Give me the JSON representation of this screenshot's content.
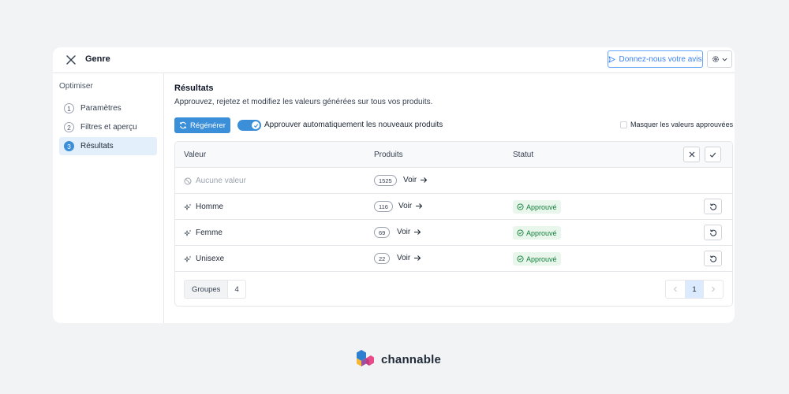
{
  "window": {
    "title": "Genre",
    "feedback_label": "Donnez-nous votre avis"
  },
  "sidebar": {
    "heading": "Optimiser",
    "steps": [
      {
        "num": "1",
        "label": "Paramètres"
      },
      {
        "num": "2",
        "label": "Filtres et aperçu"
      },
      {
        "num": "3",
        "label": "Résultats",
        "active": true
      }
    ]
  },
  "main": {
    "title": "Résultats",
    "description": "Approuvez, rejetez et modifiez les valeurs générées sur tous vos produits.",
    "regenerate_label": "Régénérer",
    "auto_approve_label": "Approuver automatiquement les nouveaux produits",
    "auto_approve_on": true,
    "hide_approved_label": "Masquer les valeurs approuvées"
  },
  "table": {
    "headers": {
      "value": "Valeur",
      "products": "Produits",
      "status": "Statut"
    },
    "rows": [
      {
        "value": "Aucune valeur",
        "count": "1525",
        "link": "Voir",
        "status": ""
      },
      {
        "value": "Homme",
        "count": "116",
        "link": "Voir",
        "status": "Approuvé"
      },
      {
        "value": "Femme",
        "count": "69",
        "link": "Voir",
        "status": "Approuvé"
      },
      {
        "value": "Unisexe",
        "count": "22",
        "link": "Voir",
        "status": "Approuvé"
      }
    ],
    "groups_label": "Groupes",
    "groups_count": "4",
    "pagination": {
      "current": "1"
    }
  },
  "brand": {
    "name": "channable"
  },
  "colors": {
    "accent": "#3b8ed8",
    "approved_bg": "#e8f6ec",
    "approved_text": "#15803d",
    "background": "#f1f3f5"
  },
  "icons": {
    "close": "close-icon",
    "feedback": "send-icon",
    "settings": "gear-icon",
    "regenerate": "refresh-icon",
    "no_value": "ban-icon",
    "generated": "sparkle-icon",
    "approved": "check-circle-icon",
    "undo": "undo-icon",
    "arrow": "arrow-right-icon"
  }
}
